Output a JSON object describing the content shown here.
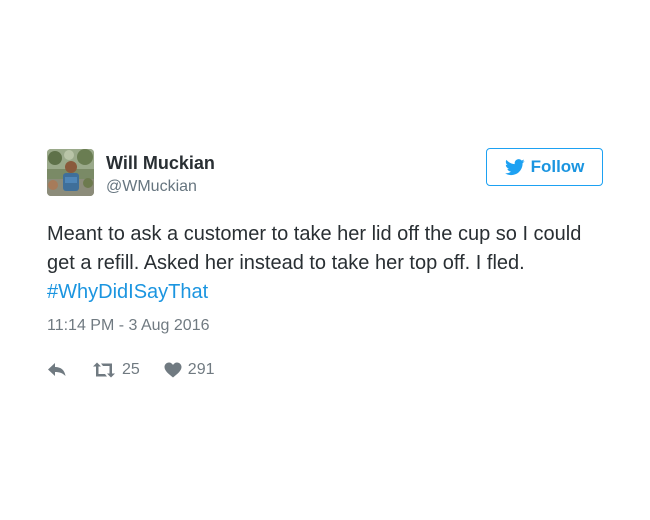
{
  "author": {
    "display_name": "Will Muckian",
    "handle": "@WMuckian"
  },
  "follow_label": "Follow",
  "tweet": {
    "text_before": "Meant to ask a customer to take her lid off the cup so I could get a refill. Asked her instead to take her top off. I fled.",
    "hashtag": "#WhyDidISayThat",
    "timestamp": "11:14 PM - 3 Aug 2016"
  },
  "actions": {
    "retweets": "25",
    "likes": "291"
  },
  "colors": {
    "accent": "#1b95e0",
    "text": "#292f33",
    "muted": "#707a81"
  },
  "icons": [
    "avatar-image",
    "twitter-bird-icon",
    "reply-icon",
    "retweet-icon",
    "heart-icon"
  ]
}
